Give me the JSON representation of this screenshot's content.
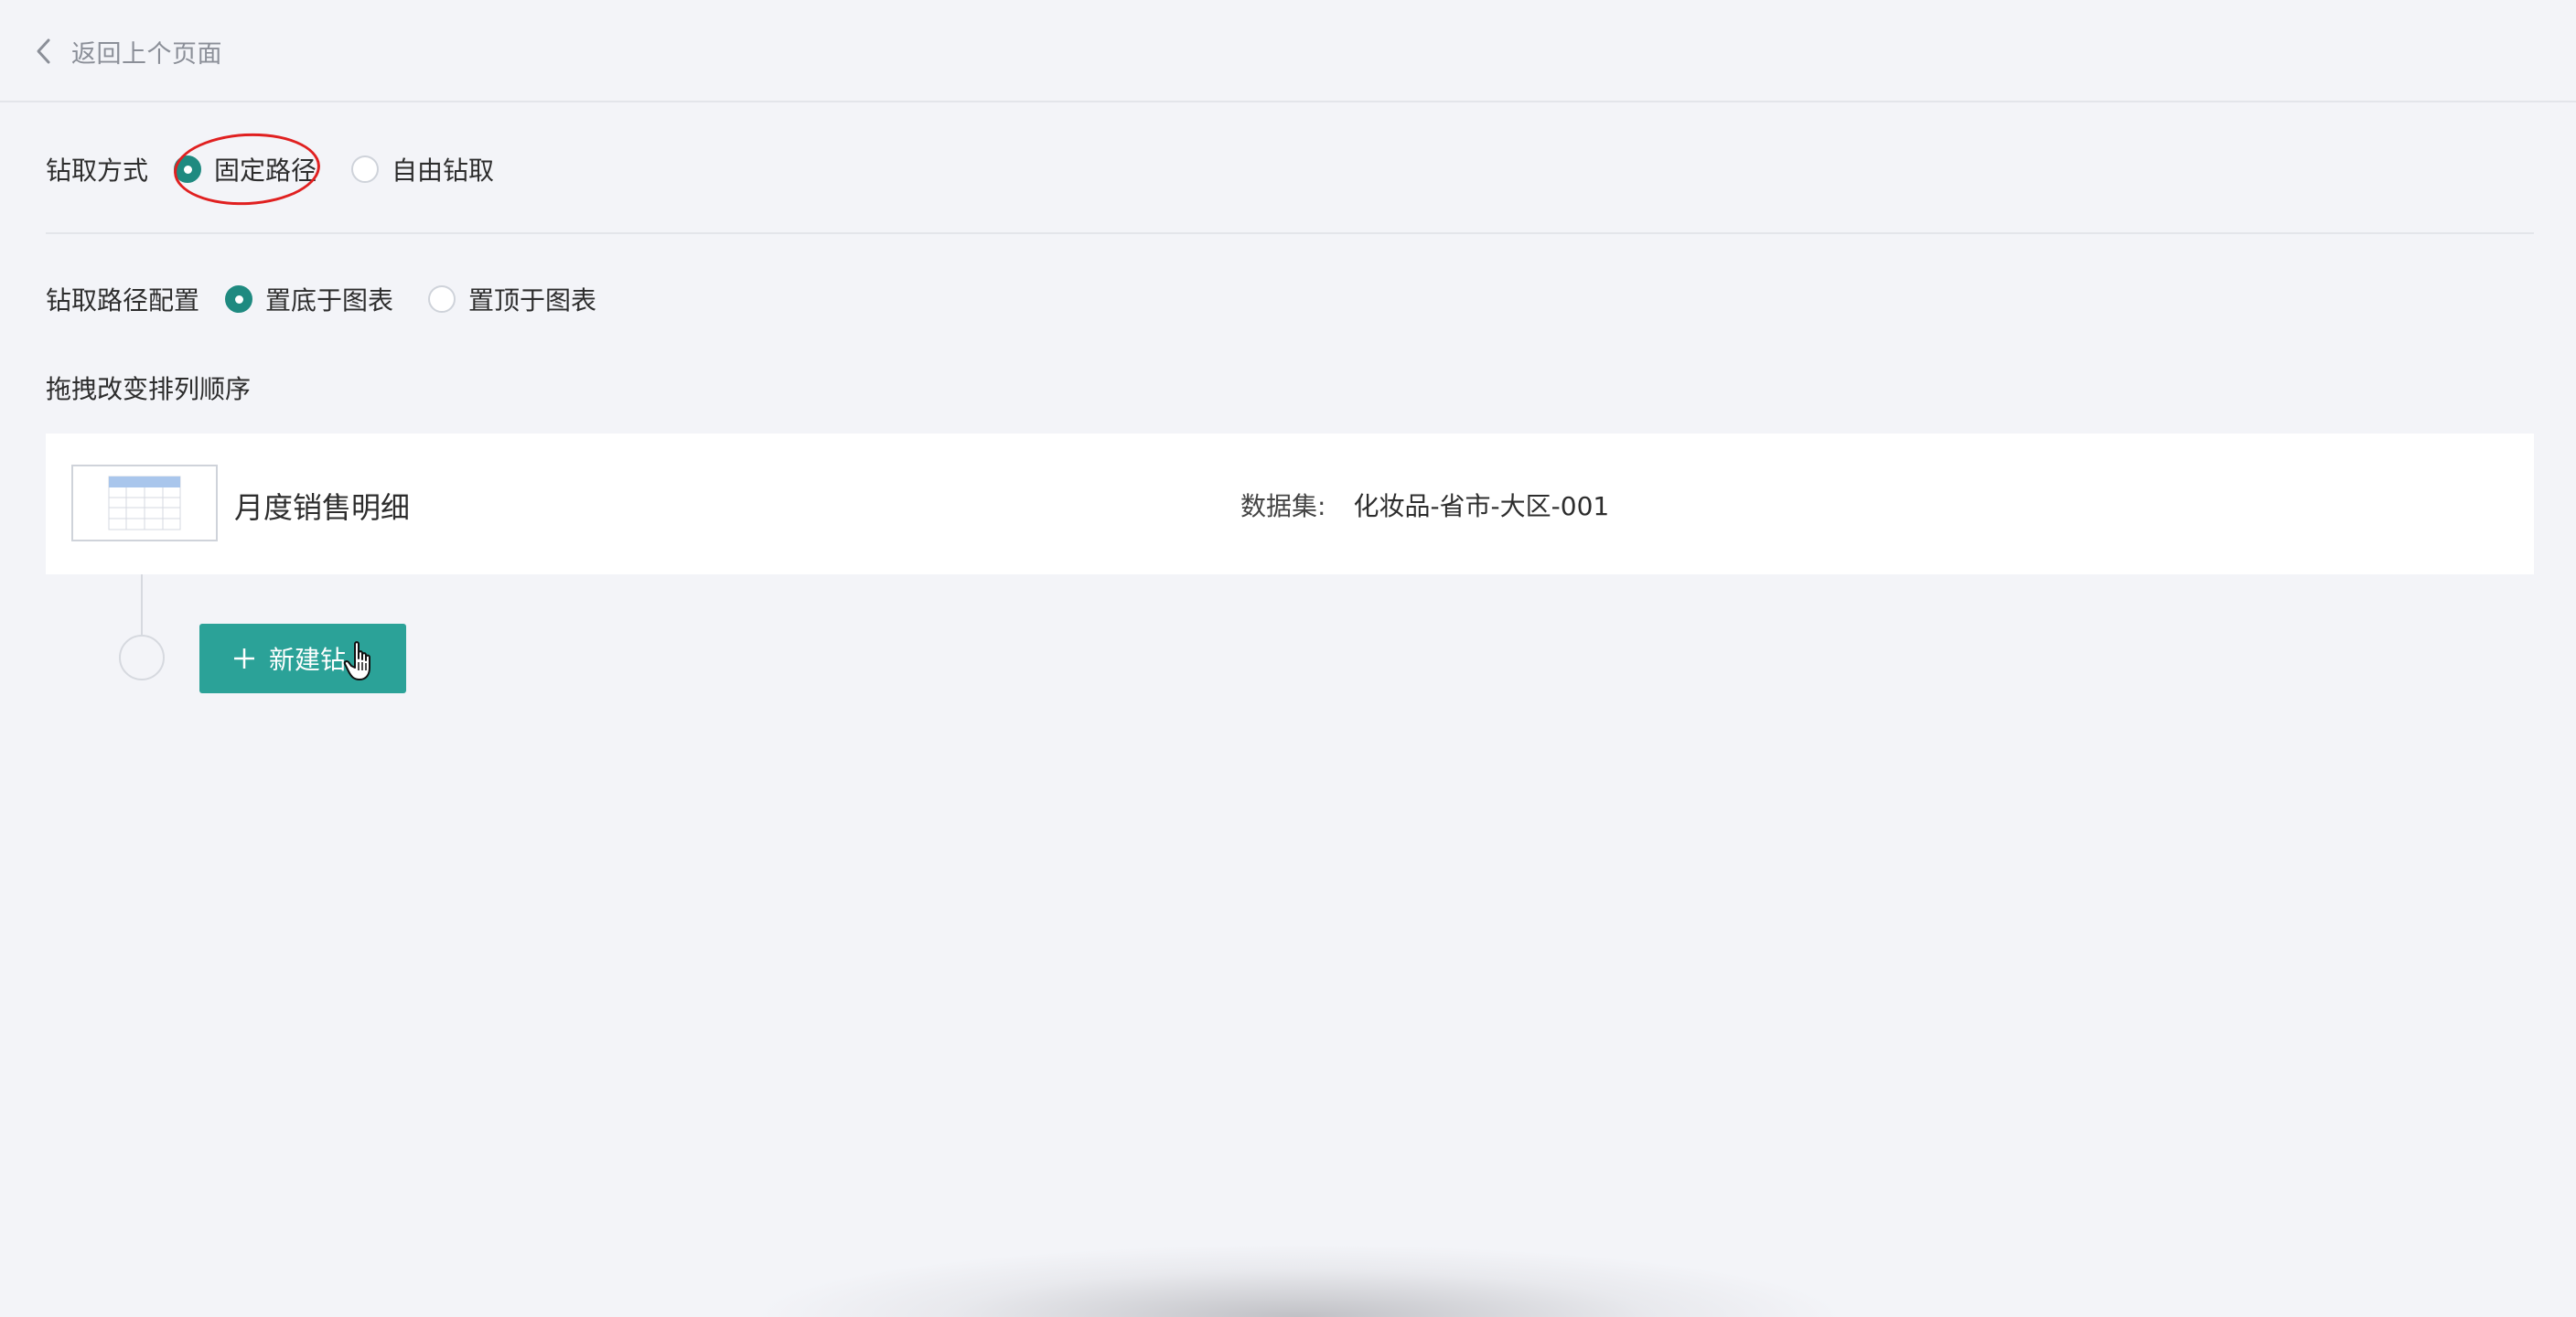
{
  "header": {
    "back_label": "返回上个页面"
  },
  "drill_mode": {
    "label": "钻取方式",
    "options": [
      {
        "label": "固定路径",
        "checked": true
      },
      {
        "label": "自由钻取",
        "checked": false
      }
    ]
  },
  "path_config": {
    "label": "钻取路径配置",
    "options": [
      {
        "label": "置底于图表",
        "checked": true
      },
      {
        "label": "置顶于图表",
        "checked": false
      }
    ]
  },
  "sort_hint": "拖拽改变排列顺序",
  "chart_card": {
    "title": "月度销售明细",
    "dataset_label": "数据集:",
    "dataset_value": "化妆品-省市-大区-001",
    "thumb_icon": "table-thumbnail-icon"
  },
  "new_drill_button": {
    "label": "新建钻",
    "icon": "plus-icon"
  },
  "colors": {
    "accent": "#2ba298",
    "radio_checked": "#1f8a80",
    "annotation": "#e02020",
    "background": "#f3f4f8"
  }
}
